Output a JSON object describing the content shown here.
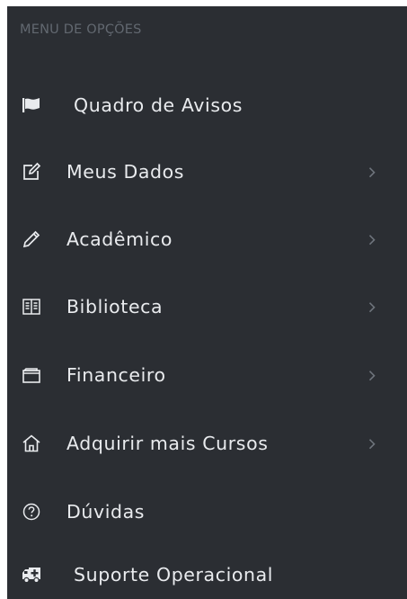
{
  "menu": {
    "header": "MENU DE OPÇÕES",
    "items": [
      {
        "label": "Quadro de Avisos",
        "icon": "flag-icon",
        "has_submenu": false
      },
      {
        "label": "Meus Dados",
        "icon": "edit-icon",
        "has_submenu": true
      },
      {
        "label": "Acadêmico",
        "icon": "pencil-icon",
        "has_submenu": true
      },
      {
        "label": "Biblioteca",
        "icon": "book-icon",
        "has_submenu": true
      },
      {
        "label": "Financeiro",
        "icon": "wallet-icon",
        "has_submenu": true
      },
      {
        "label": "Adquirir mais Cursos",
        "icon": "home-icon",
        "has_submenu": true
      },
      {
        "label": "Dúvidas",
        "icon": "question-circle-icon",
        "has_submenu": false
      },
      {
        "label": "Suporte Operacional",
        "icon": "ambulance-icon",
        "has_submenu": false
      }
    ]
  },
  "colors": {
    "background": "#2b2e33",
    "text": "#e9ebee",
    "header_text": "#626870",
    "chevron": "#6e747c"
  }
}
